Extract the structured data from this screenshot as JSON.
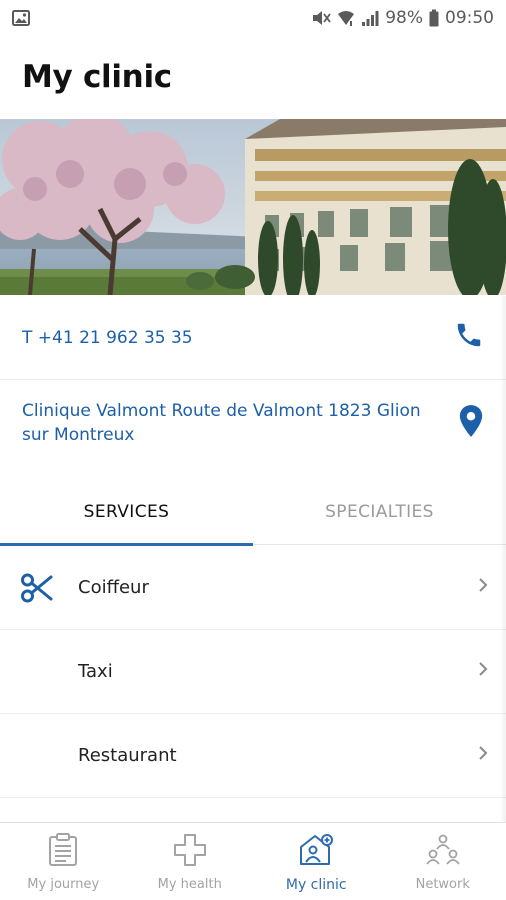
{
  "status_bar": {
    "battery": "98%",
    "time": "09:50"
  },
  "header": {
    "title": "My clinic"
  },
  "contact": {
    "phone": "T +41 21 962 35 35",
    "address": "Clinique Valmont Route de Valmont 1823 Glion sur Montreux"
  },
  "tabs": [
    {
      "label": "SERVICES",
      "active": true
    },
    {
      "label": "SPECIALTIES",
      "active": false
    }
  ],
  "services": [
    {
      "label": "Coiffeur",
      "icon": "scissors-icon"
    },
    {
      "label": "Taxi",
      "icon": ""
    },
    {
      "label": "Restaurant",
      "icon": ""
    }
  ],
  "bottom_nav": [
    {
      "label": "My journey",
      "icon": "clipboard-icon",
      "active": false
    },
    {
      "label": "My health",
      "icon": "medical-cross-icon",
      "active": false
    },
    {
      "label": "My clinic",
      "icon": "clinic-icon",
      "active": true
    },
    {
      "label": "Network",
      "icon": "network-icon",
      "active": false
    }
  ],
  "colors": {
    "accent": "#2d6bb0",
    "link": "#1d5fa8",
    "inactive": "#a3a3a3"
  }
}
